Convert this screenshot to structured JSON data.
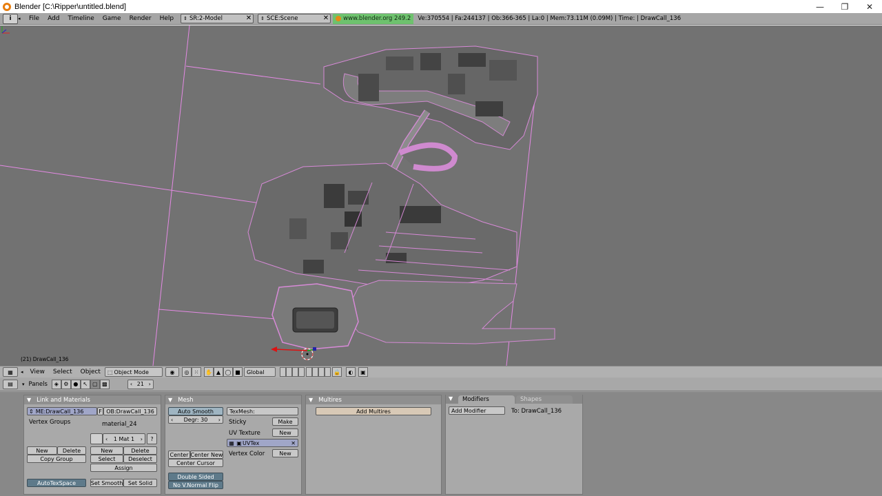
{
  "window": {
    "title": "Blender [C:\\Ripper\\untitled.blend]",
    "minimize": "—",
    "maximize": "❐",
    "close": "✕"
  },
  "info_header": {
    "window_type": "i",
    "menus": [
      "File",
      "Add",
      "Timeline",
      "Game",
      "Render",
      "Help"
    ],
    "screen": "SR:2-Model",
    "scene": "SCE:Scene",
    "website": "www.blender.org 249.2",
    "stats": "Ve:370554 | Fa:244137 | Ob:366-365 | La:0 | Mem:73.11M (0.09M) | Time: | DrawCall_136"
  },
  "viewport": {
    "object_info": "(21) DrawCall_136"
  },
  "view3d_header": {
    "menus": [
      "View",
      "Select",
      "Object"
    ],
    "mode": "Object Mode",
    "orientation": "Global"
  },
  "buttons_header": {
    "panels_label": "Panels",
    "frame": "21"
  },
  "link_materials": {
    "title": "Link and Materials",
    "mesh_name": "ME:DrawCall_136",
    "f_label": "F",
    "object_name": "OB:DrawCall_136",
    "vertex_groups": "Vertex Groups",
    "material_name": "material_24",
    "mat_index": "1 Mat 1",
    "question": "?",
    "new": "New",
    "delete": "Delete",
    "copy_group": "Copy Group",
    "mat_new": "New",
    "mat_delete": "Delete",
    "select": "Select",
    "deselect": "Deselect",
    "assign": "Assign",
    "autotexspace": "AutoTexSpace",
    "set_smooth": "Set Smooth",
    "set_solid": "Set Solid"
  },
  "mesh": {
    "title": "Mesh",
    "auto_smooth": "Auto Smooth",
    "degr": "Degr: 30",
    "texmesh": "TexMesh:",
    "sticky": "Sticky",
    "make": "Make",
    "uv_texture": "UV Texture",
    "uv_new": "New",
    "uvtex": "UVTex",
    "vertex_color": "Vertex Color",
    "vc_new": "New",
    "center": "Center",
    "center_new": "Center New",
    "center_cursor": "Center Cursor",
    "double_sided": "Double Sided",
    "no_vnormal_flip": "No V.Normal Flip"
  },
  "multires": {
    "title": "Multires",
    "add_multires": "Add Multires"
  },
  "modifiers": {
    "tab_modifiers": "Modifiers",
    "tab_shapes": "Shapes",
    "add_modifier": "Add Modifier",
    "to_label": "To: DrawCall_136"
  }
}
